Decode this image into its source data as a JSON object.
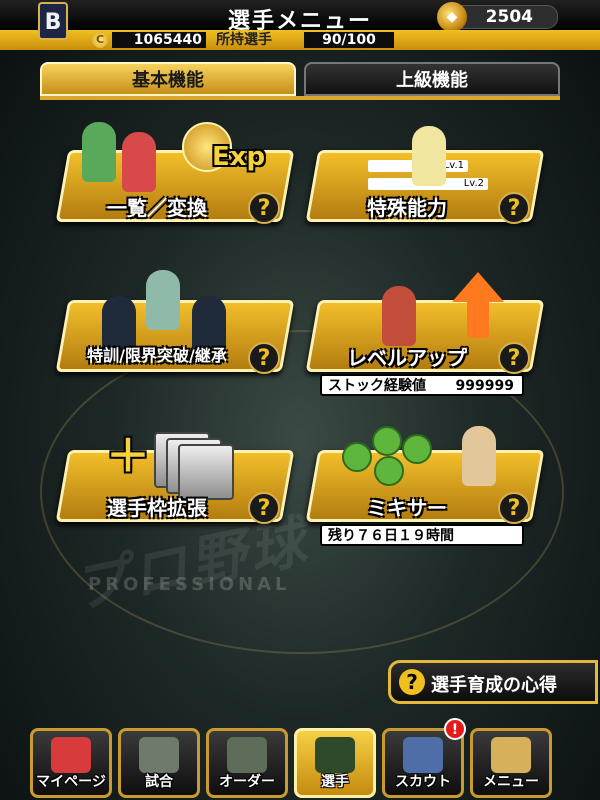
{
  "header": {
    "title": "選手メニュー",
    "team_logo": "B",
    "gems": "2504",
    "coins": "1065440",
    "owned_label": "所持選手",
    "owned_count": "90/100"
  },
  "tabs": [
    {
      "label": "基本機能",
      "active": true
    },
    {
      "label": "上級機能",
      "active": false
    }
  ],
  "background": {
    "watermark_sub": "PROFESSIONAL"
  },
  "cards": {
    "list_convert": {
      "label": "一覧／変換",
      "art_text": "Exp",
      "help": "?"
    },
    "special_ability": {
      "label": "特殊能力",
      "lv1": "Lv.1",
      "lv2": "Lv.2",
      "help": "?"
    },
    "training": {
      "label": "特訓/限界突破/継承",
      "help": "?"
    },
    "level_up": {
      "label": "レベルアップ",
      "info_label": "ストック経験値",
      "info_value": "999999",
      "help": "?"
    },
    "expand_slots": {
      "label": "選手枠拡張",
      "help": "?"
    },
    "mixer": {
      "label": "ミキサー",
      "info_label": "残り７６日１９時間",
      "help": "?"
    }
  },
  "guide_button": {
    "icon_text": "?",
    "label": "選手育成の心得"
  },
  "bottom_nav": [
    {
      "label": "マイページ",
      "icon": "mypage-icon"
    },
    {
      "label": "試合",
      "icon": "stadium-icon"
    },
    {
      "label": "オーダー",
      "icon": "lineup-icon"
    },
    {
      "label": "選手",
      "icon": "player-icon",
      "active": true
    },
    {
      "label": "スカウト",
      "icon": "scout-icon"
    },
    {
      "label": "メニュー",
      "icon": "menu-icon"
    }
  ],
  "notification_badge": "!",
  "colors": {
    "accent_gold": "#f0c020",
    "badge_red": "#e31b1b"
  }
}
